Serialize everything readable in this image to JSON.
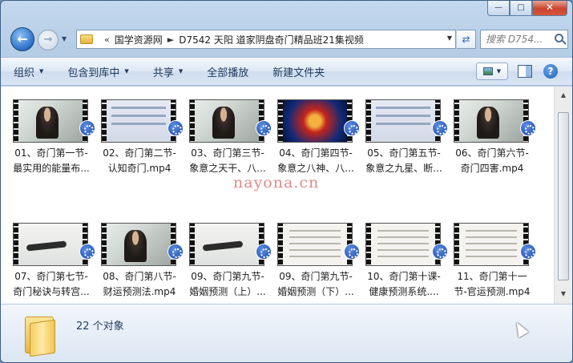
{
  "window": {
    "minimize_glyph": "—",
    "maximize_glyph": "□",
    "close_glyph": "✕"
  },
  "nav": {
    "back_glyph": "←",
    "forward_glyph": "→",
    "breadcrumb_prefix": "«",
    "breadcrumbs": [
      "国学资源网",
      "D7542 天阳 道家阴盘奇门精品班21集视频"
    ],
    "search_placeholder": "搜索 D754..."
  },
  "toolbar": {
    "organize": "组织",
    "include_in_library": "包含到库中",
    "share": "共享",
    "play_all": "全部播放",
    "new_folder": "新建文件夹",
    "help": "?"
  },
  "files": [
    {
      "line1": "01、奇门第一节-",
      "line2": "最实用的能量布...",
      "thumb": "video"
    },
    {
      "line1": "02、奇门第二节-",
      "line2": "认知奇门.mp4",
      "thumb": "screen"
    },
    {
      "line1": "03、奇门第三节-",
      "line2": "象意之天干、八...",
      "thumb": "video"
    },
    {
      "line1": "04、奇门第四节-",
      "line2": "象意之八神、八...",
      "thumb": "yinyang"
    },
    {
      "line1": "05、奇门第五节-",
      "line2": "象意之九星、断...",
      "thumb": "screen"
    },
    {
      "line1": "06、奇门第六节-",
      "line2": "奇门四害.mp4",
      "thumb": "video"
    },
    {
      "line1": "07、奇门第七节-",
      "line2": "奇门秘诀与转宫...",
      "thumb": "slide"
    },
    {
      "line1": "08、奇门第八节-",
      "line2": "财运预测法.mp4",
      "thumb": "video"
    },
    {
      "line1": "09、奇门第九节-",
      "line2": "婚姻预测（上）...",
      "thumb": "slide"
    },
    {
      "line1": "09、奇门第九节-",
      "line2": "婚姻预测（下）...",
      "thumb": "doc"
    },
    {
      "line1": "10、奇门第十课-",
      "line2": "健康预测系统....",
      "thumb": "doc"
    },
    {
      "line1": "11、奇门第十一",
      "line2": "节-官运预测.mp4",
      "thumb": "doc"
    }
  ],
  "watermark": "nayona.cn",
  "details": {
    "object_count": "22 个对象"
  }
}
